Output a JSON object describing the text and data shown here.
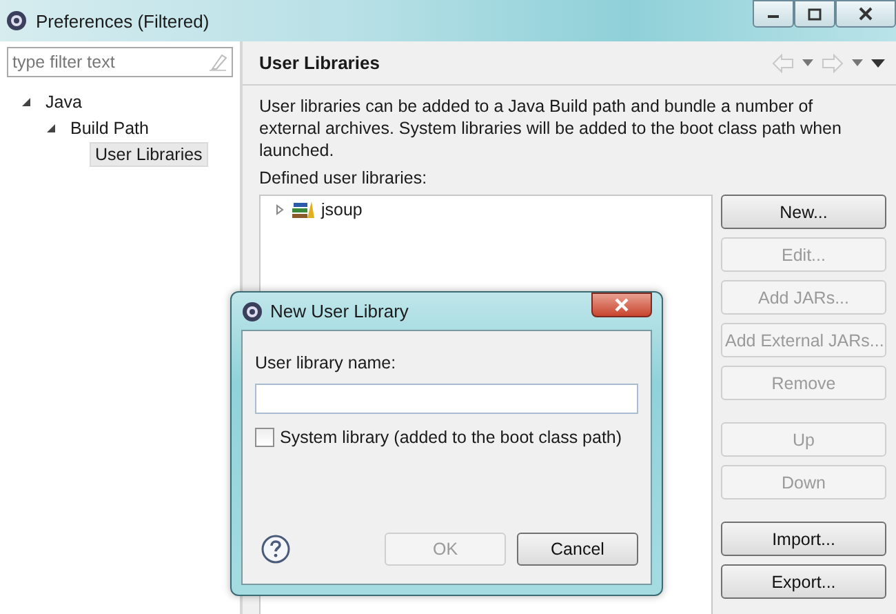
{
  "window": {
    "title": "Preferences (Filtered)"
  },
  "filter": {
    "placeholder": "type filter text"
  },
  "tree": [
    {
      "label": "Java",
      "expanded": true,
      "selected": false,
      "children": [
        {
          "label": "Build Path",
          "expanded": true,
          "selected": false,
          "children": [
            {
              "label": "User Libraries",
              "selected": true
            }
          ]
        }
      ]
    }
  ],
  "page": {
    "title": "User Libraries",
    "description": "User libraries can be added to a Java Build path and bundle a number of external archives. System libraries will be added to the boot class path when launched.",
    "list_label": "Defined user libraries:",
    "libraries": [
      {
        "label": "jsoup",
        "expanded": false
      }
    ],
    "button_groups": [
      [
        {
          "label": "New...",
          "disabled": false
        },
        {
          "label": "Edit...",
          "disabled": true
        },
        {
          "label": "Add JARs...",
          "disabled": true
        },
        {
          "label": "Add External JARs...",
          "disabled": true
        },
        {
          "label": "Remove",
          "disabled": true
        }
      ],
      [
        {
          "label": "Up",
          "disabled": true
        },
        {
          "label": "Down",
          "disabled": true
        }
      ],
      [
        {
          "label": "Import...",
          "disabled": false
        },
        {
          "label": "Export...",
          "disabled": false
        }
      ]
    ]
  },
  "dialog": {
    "title": "New User Library",
    "name_label": "User library name:",
    "system_checkbox": {
      "label": "System library (added to the boot class path)",
      "checked": false
    },
    "buttons": [
      {
        "label": "OK",
        "disabled": true
      },
      {
        "label": "Cancel",
        "disabled": false
      }
    ]
  }
}
